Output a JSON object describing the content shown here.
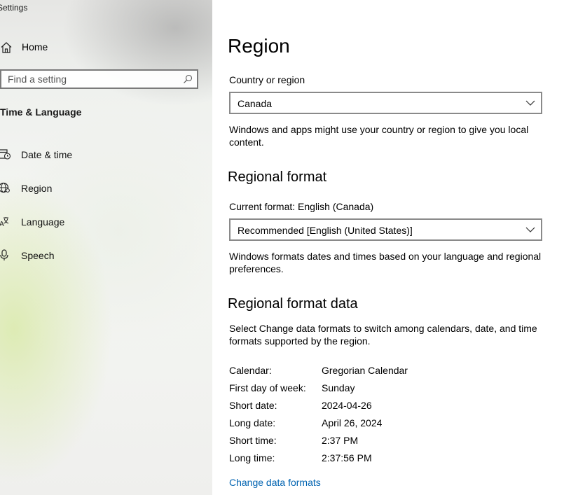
{
  "window": {
    "title": "Settings"
  },
  "sidebar": {
    "home_label": "Home",
    "search": {
      "placeholder": "Find a setting",
      "value": ""
    },
    "section_title": "Time & Language",
    "items": [
      {
        "label": "Date & time",
        "icon": "calendar-clock-icon"
      },
      {
        "label": "Region",
        "icon": "globe-icon"
      },
      {
        "label": "Language",
        "icon": "language-icon"
      },
      {
        "label": "Speech",
        "icon": "microphone-icon"
      }
    ]
  },
  "main": {
    "title": "Region",
    "country": {
      "label": "Country or region",
      "selected": "Canada",
      "description": "Windows and apps might use your country or region to give you local content."
    },
    "regional_format": {
      "heading": "Regional format",
      "current_label": "Current format: English (Canada)",
      "selected": "Recommended [English (United States)]",
      "description": "Windows formats dates and times based on your language and regional preferences."
    },
    "format_data": {
      "heading": "Regional format data",
      "description": "Select Change data formats to switch among calendars, date, and time formats supported by the region.",
      "rows": [
        {
          "key": "Calendar:",
          "value": "Gregorian Calendar"
        },
        {
          "key": "First day of week:",
          "value": "Sunday"
        },
        {
          "key": "Short date:",
          "value": "2024-04-26"
        },
        {
          "key": "Long date:",
          "value": "April 26, 2024"
        },
        {
          "key": "Short time:",
          "value": "2:37 PM"
        },
        {
          "key": "Long time:",
          "value": "2:37:56 PM"
        }
      ],
      "link_label": "Change data formats"
    }
  },
  "colors": {
    "link": "#0063b1",
    "border": "#8a8a8a"
  }
}
